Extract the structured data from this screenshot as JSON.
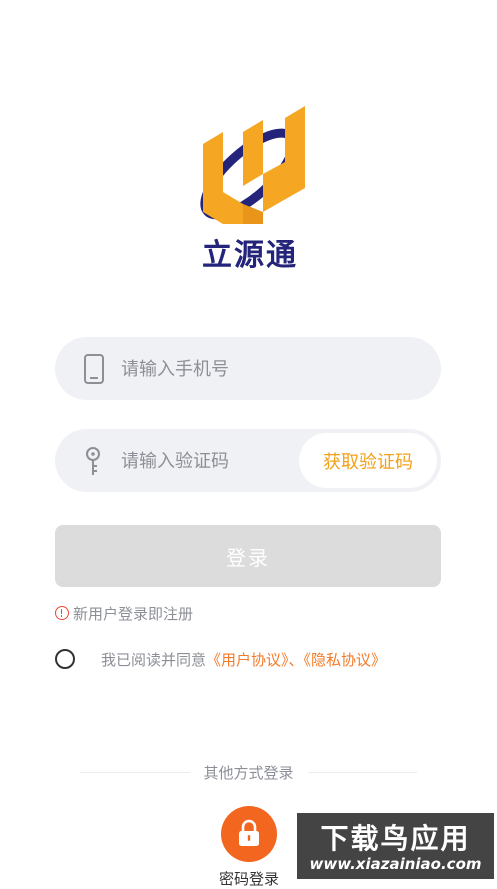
{
  "app": {
    "brand_name": "立源通"
  },
  "form": {
    "phone_placeholder": "请输入手机号",
    "code_placeholder": "请输入验证码",
    "get_code_label": "获取验证码",
    "login_label": "登录",
    "notice": "新用户登录即注册",
    "agree_prefix": "我已阅读并同意",
    "user_agreement": "《用户协议》",
    "separator": "、",
    "privacy_policy": "《隐私协议》",
    "agree_checked": false
  },
  "other": {
    "divider_label": "其他方式登录",
    "method_label": "密码登录",
    "method_icon": "lock-icon"
  },
  "watermark": {
    "title": "下载鸟应用",
    "url": "www.xiazainiao.com"
  },
  "colors": {
    "accent_orange": "#f3a01a",
    "link_orange": "#f27b2a",
    "brand_navy": "#23247a",
    "lock_button": "#f3661f",
    "disabled_button": "#dcdcdc"
  }
}
